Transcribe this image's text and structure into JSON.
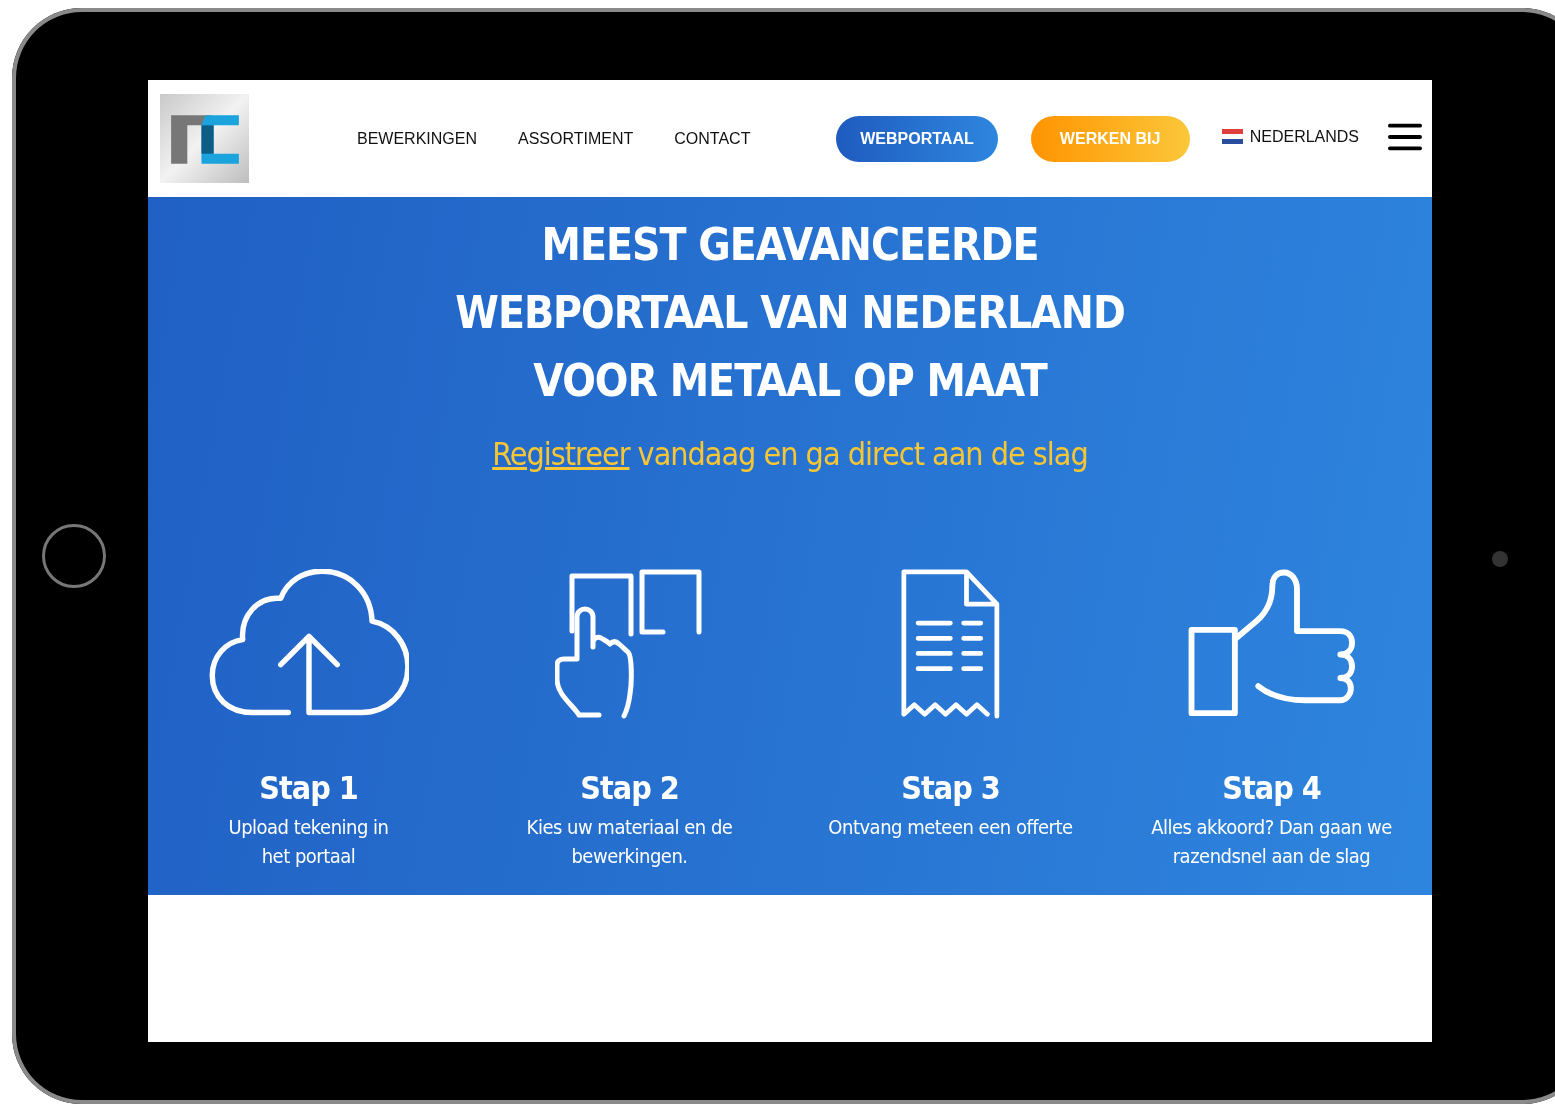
{
  "header": {
    "nav": [
      "BEWERKINGEN",
      "ASSORTIMENT",
      "CONTACT"
    ],
    "buttons": [
      {
        "label": "WEBPORTAAL",
        "kind": "primary"
      },
      {
        "label": "WERKEN BIJ",
        "kind": "accent"
      }
    ],
    "language": "NEDERLANDS"
  },
  "hero": {
    "title_lines": [
      "MEEST GEAVANCEERDE",
      "WEBPORTAAL VAN NEDERLAND",
      "VOOR METAAL OP MAAT"
    ],
    "subtitle": {
      "link": "Registreer",
      "text": " vandaag en ga direct aan de slag"
    }
  },
  "steps": [
    {
      "kind": "upload",
      "title": "Stap 1",
      "description": "Upload tekening in\nhet portaal"
    },
    {
      "kind": "touch",
      "title": "Stap 2",
      "description": "Kies uw materiaal en de\nbewerkingen."
    },
    {
      "kind": "receipt",
      "title": "Stap 3",
      "description": "Ontvang meteen een offerte"
    },
    {
      "kind": "thumbs",
      "title": "Stap 4",
      "description": "Alles akkoord? Dan gaan we\nrazendsnel aan de slag"
    }
  ]
}
